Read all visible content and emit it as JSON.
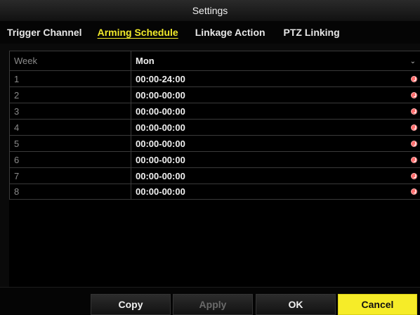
{
  "window": {
    "title": "Settings"
  },
  "tabs": [
    {
      "label": "Trigger Channel",
      "active": false
    },
    {
      "label": "Arming Schedule",
      "active": true
    },
    {
      "label": "Linkage Action",
      "active": false
    },
    {
      "label": "PTZ Linking",
      "active": false
    }
  ],
  "schedule": {
    "header_label": "Week",
    "selected_day": "Mon",
    "rows": [
      {
        "index": "1",
        "time": "00:00-24:00",
        "icon": "clock-icon"
      },
      {
        "index": "2",
        "time": "00:00-00:00",
        "icon": "clock-icon"
      },
      {
        "index": "3",
        "time": "00:00-00:00",
        "icon": "clock-icon"
      },
      {
        "index": "4",
        "time": "00:00-00:00",
        "icon": "clock-icon"
      },
      {
        "index": "5",
        "time": "00:00-00:00",
        "icon": "clock-icon"
      },
      {
        "index": "6",
        "time": "00:00-00:00",
        "icon": "clock-icon"
      },
      {
        "index": "7",
        "time": "00:00-00:00",
        "icon": "clock-icon"
      },
      {
        "index": "8",
        "time": "00:00-00:00",
        "icon": "clock-icon"
      }
    ]
  },
  "buttons": {
    "copy": "Copy",
    "apply": "Apply",
    "ok": "OK",
    "cancel": "Cancel"
  },
  "colors": {
    "accent_yellow": "#f6ec28",
    "tab_active": "#f2ea2a",
    "clock_icon": "#ff6a6a",
    "background": "#000000"
  }
}
